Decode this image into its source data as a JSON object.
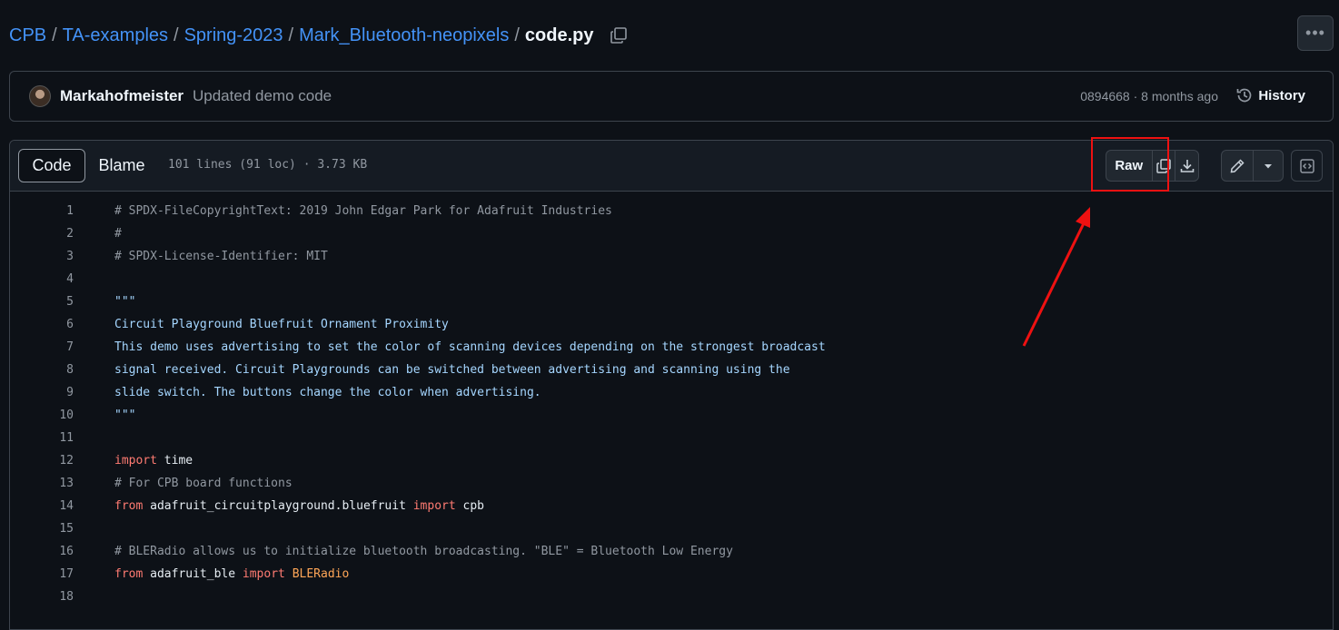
{
  "breadcrumb": {
    "items": [
      "CPB",
      "TA-examples",
      "Spring-2023",
      "Mark_Bluetooth-neopixels"
    ],
    "separator": "/",
    "current_file": "code.py"
  },
  "commit": {
    "author": "Markahofmeister",
    "message": "Updated demo code",
    "meta": "0894668 · 8 months ago",
    "history_label": "History"
  },
  "file_header": {
    "tabs": [
      "Code",
      "Blame"
    ],
    "active_tab": "Code",
    "info": "101 lines (91 loc) · 3.73 KB",
    "raw_label": "Raw"
  },
  "colors": {
    "background": "#0d1117",
    "link": "#4493f8",
    "annotation": "#ee1111",
    "comment": "#9198a1",
    "string": "#a5d6ff",
    "keyword": "#ff7b72",
    "class": "#ffa657"
  },
  "code_lines": [
    {
      "n": "1",
      "tokens": [
        {
          "t": "# SPDX-FileCopyrightText: 2019 John Edgar Park for Adafruit Industries",
          "c": "comment"
        }
      ]
    },
    {
      "n": "2",
      "tokens": [
        {
          "t": "#",
          "c": "comment"
        }
      ]
    },
    {
      "n": "3",
      "tokens": [
        {
          "t": "# SPDX-License-Identifier: MIT",
          "c": "comment"
        }
      ]
    },
    {
      "n": "4",
      "tokens": []
    },
    {
      "n": "5",
      "tokens": [
        {
          "t": "\"\"\"",
          "c": "string"
        }
      ]
    },
    {
      "n": "6",
      "tokens": [
        {
          "t": "Circuit Playground Bluefruit Ornament Proximity",
          "c": "string"
        }
      ]
    },
    {
      "n": "7",
      "tokens": [
        {
          "t": "This demo uses advertising to set the color of scanning devices depending on the strongest broadcast",
          "c": "string"
        }
      ]
    },
    {
      "n": "8",
      "tokens": [
        {
          "t": "signal received. Circuit Playgrounds can be switched between advertising and scanning using the",
          "c": "string"
        }
      ]
    },
    {
      "n": "9",
      "tokens": [
        {
          "t": "slide switch. The buttons change the color when advertising.",
          "c": "string"
        }
      ]
    },
    {
      "n": "10",
      "tokens": [
        {
          "t": "\"\"\"",
          "c": "string"
        }
      ]
    },
    {
      "n": "11",
      "tokens": []
    },
    {
      "n": "12",
      "tokens": [
        {
          "t": "import",
          "c": "keyword"
        },
        {
          "t": " time",
          "c": "plain"
        }
      ]
    },
    {
      "n": "13",
      "tokens": [
        {
          "t": "# For CPB board functions",
          "c": "comment"
        }
      ]
    },
    {
      "n": "14",
      "tokens": [
        {
          "t": "from",
          "c": "keyword"
        },
        {
          "t": " adafruit_circuitplayground.bluefruit ",
          "c": "plain"
        },
        {
          "t": "import",
          "c": "keyword"
        },
        {
          "t": " cpb",
          "c": "plain"
        }
      ]
    },
    {
      "n": "15",
      "tokens": []
    },
    {
      "n": "16",
      "tokens": [
        {
          "t": "# BLERadio allows us to initialize bluetooth broadcasting. \"BLE\" = Bluetooth Low Energy",
          "c": "comment"
        }
      ]
    },
    {
      "n": "17",
      "tokens": [
        {
          "t": "from",
          "c": "keyword"
        },
        {
          "t": " adafruit_ble ",
          "c": "plain"
        },
        {
          "t": "import",
          "c": "keyword"
        },
        {
          "t": " ",
          "c": "plain"
        },
        {
          "t": "BLERadio",
          "c": "class"
        }
      ]
    },
    {
      "n": "18",
      "tokens": []
    }
  ]
}
